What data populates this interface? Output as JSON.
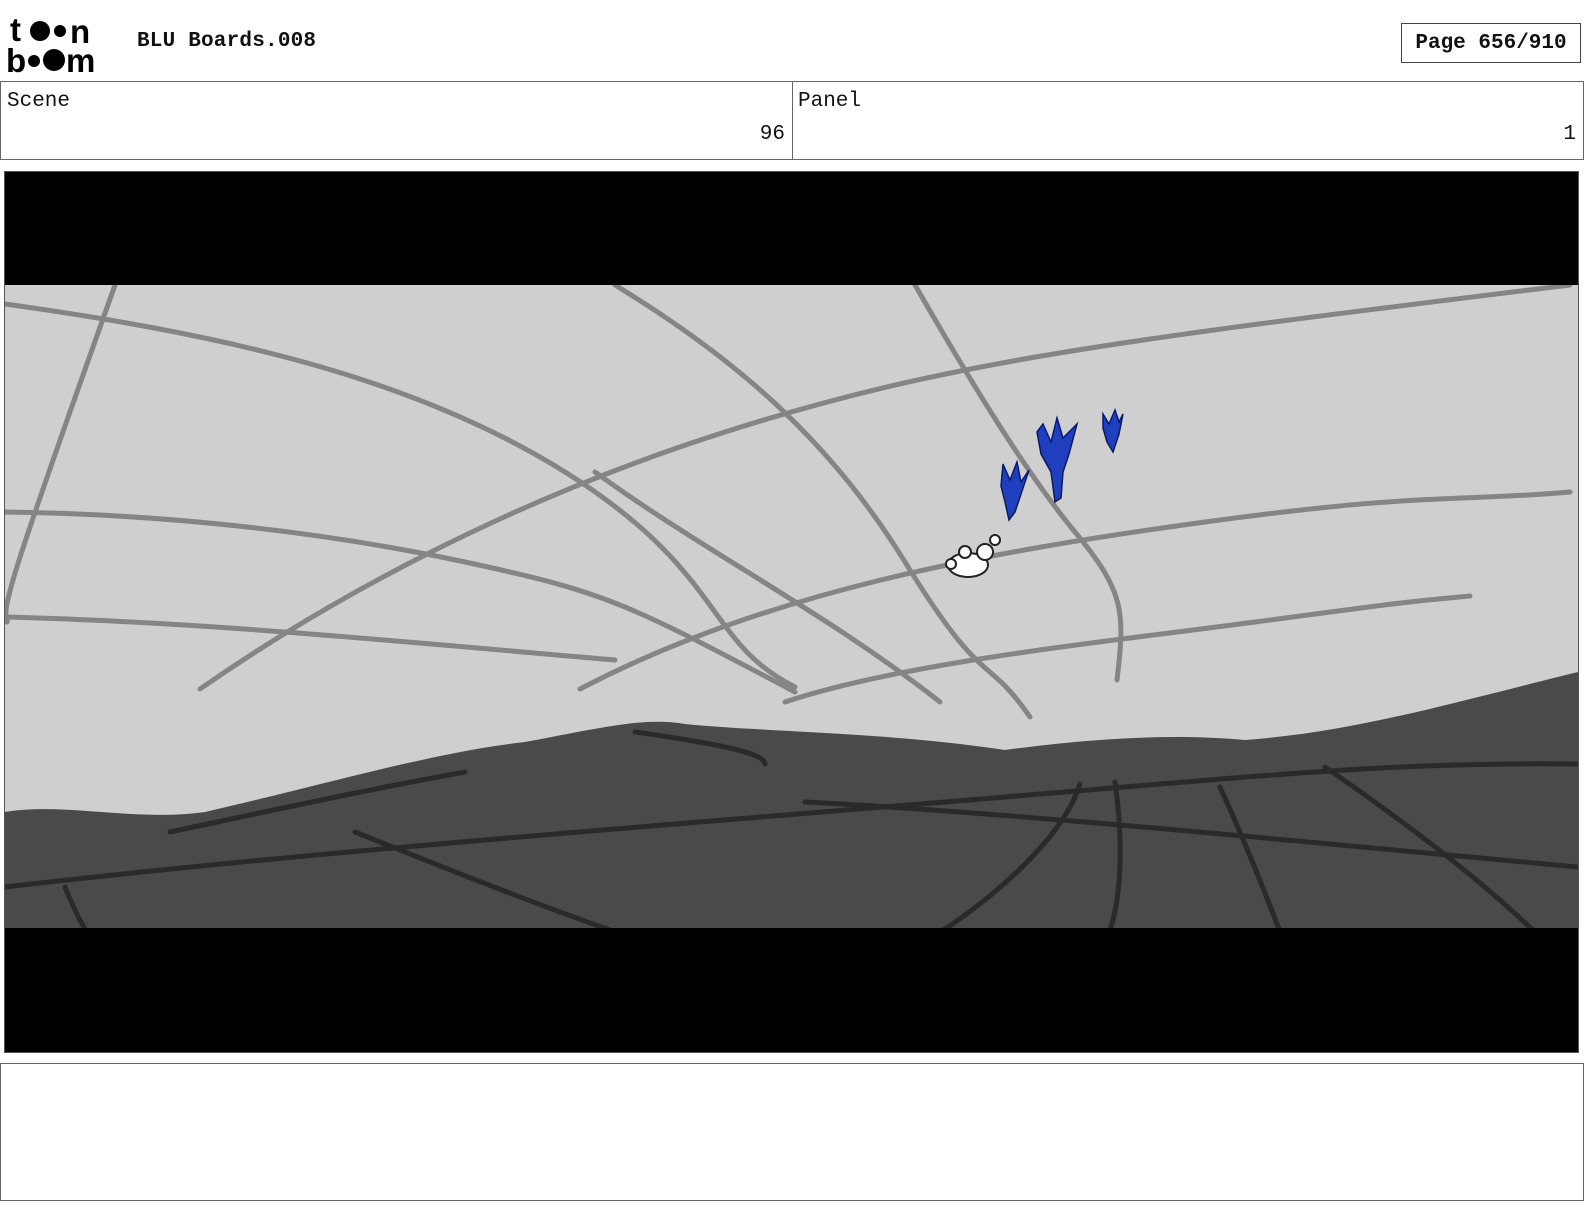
{
  "header": {
    "logo_name": "toonboom-logo",
    "title": "BLU Boards.008",
    "page_label": "Page 656/910"
  },
  "info": {
    "scene_label": "Scene",
    "scene_value": "96",
    "panel_label": "Panel",
    "panel_value": "1"
  },
  "panel_image": {
    "sky_color": "#cfcfcf",
    "ground_color": "#4a4a4a",
    "letterbox_color": "#000000",
    "figure_color": "#1f3fbf"
  },
  "notes": {
    "text": ""
  }
}
